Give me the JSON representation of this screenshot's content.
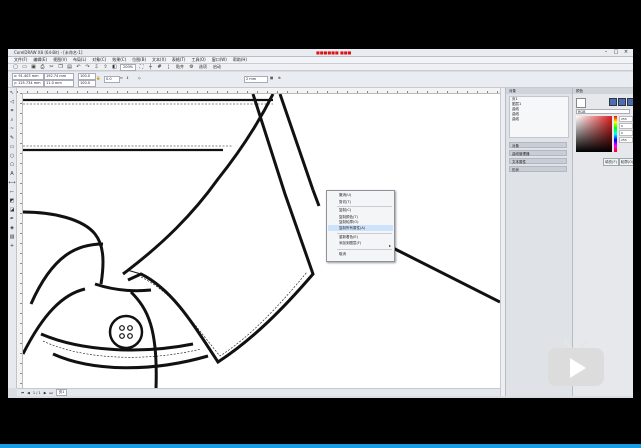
{
  "window": {
    "title": "CorelDRAW X8 (64-Bit) - [未命名-1]",
    "notice": "■■■■■■ ■■■"
  },
  "menu": [
    "文件(F)",
    "编辑(E)",
    "视图(V)",
    "布局(L)",
    "对象(C)",
    "效果(C)",
    "位图(B)",
    "文本(X)",
    "表格(T)",
    "工具(O)",
    "窗口(W)",
    "帮助(H)"
  ],
  "toolbar": {
    "zoom": "200%",
    "snap_label": "贴齐",
    "options_label": "选项",
    "launch_label": "启动"
  },
  "propbar": {
    "x": "x: 91.403 mm",
    "y": "y: 125.734 mm",
    "w": "192.74 mm",
    "h": "11.0 mm",
    "sx": "100.0",
    "sy": "100.0",
    "angle": "0.0",
    "outline": "2 mm"
  },
  "canvas_objects": {
    "buttons": [
      "button",
      "button"
    ]
  },
  "context_menu": {
    "items": [
      {
        "label": "撤消(U)"
      },
      {
        "label": "剪切(T)"
      },
      {
        "label": "复制(C)"
      },
      {
        "label": "复制颜色(T)"
      },
      {
        "label": "复制轮廓(O)"
      },
      {
        "label": "复制所有属性(A)"
      },
      {
        "label": "重新着色(E)"
      },
      {
        "label": "添加到图层(F)"
      },
      {
        "label": "取消"
      }
    ],
    "highlighted_index": 5
  },
  "status": {
    "page_count": "1 / 1",
    "page_tab": "页1"
  },
  "docker": {
    "title": "对象",
    "tree": [
      "页1",
      "图层1",
      "曲线",
      "曲线",
      "曲线"
    ],
    "sections": [
      "对象",
      "曲线管理器",
      "文本属性",
      "形状"
    ]
  },
  "color_panel": {
    "title": "颜色",
    "model": "RGB",
    "values": [
      "255",
      "0",
      "0",
      "255"
    ],
    "fill_button": "填充(F)",
    "outline_button": "轮廓(O)"
  },
  "colors": {
    "accent": "#1a9be6",
    "notice_red": "#dd1111",
    "highlight": "#cde3fb"
  }
}
